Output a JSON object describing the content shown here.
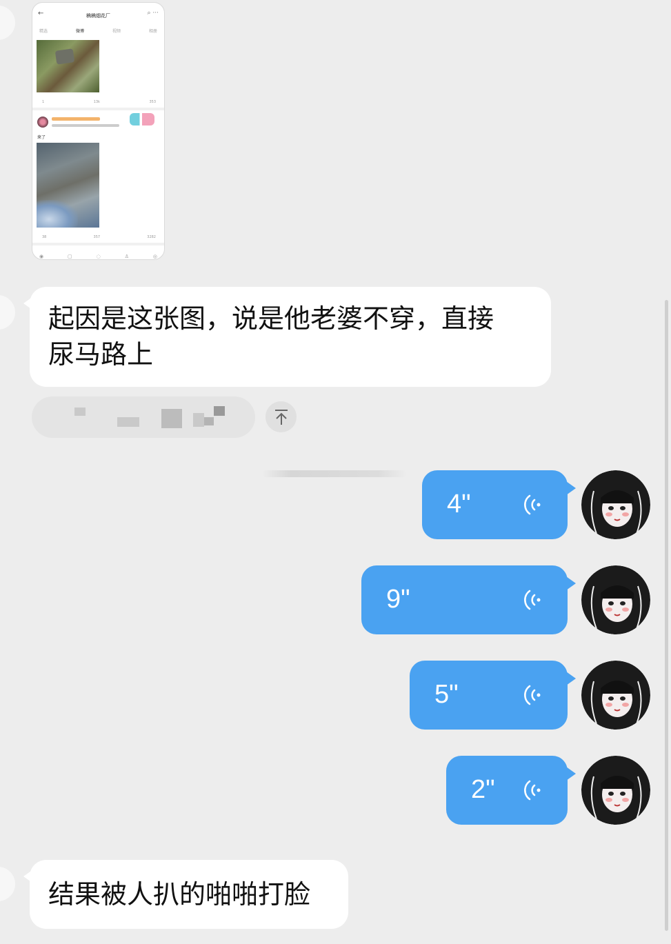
{
  "thumbnail": {
    "title": "稿稿烟花厂",
    "tabs": [
      "精选",
      "微博",
      "视频",
      "相册"
    ],
    "post_text": "来了",
    "stats_row1": [
      "1",
      "13k",
      "353"
    ],
    "stats_row2": [
      "38",
      "357",
      "3282"
    ]
  },
  "messages": {
    "text1": "起因是这张图，说是他老婆不穿，直接\n尿马路上",
    "text2": "结果被人扒的啪啪打脸",
    "voice": [
      {
        "duration": "4\""
      },
      {
        "duration": "9\""
      },
      {
        "duration": "5\""
      },
      {
        "duration": "2\""
      }
    ]
  },
  "colors": {
    "background": "#ededed",
    "outgoing_bubble": "#4aa2f1",
    "incoming_bubble": "#ffffff"
  }
}
